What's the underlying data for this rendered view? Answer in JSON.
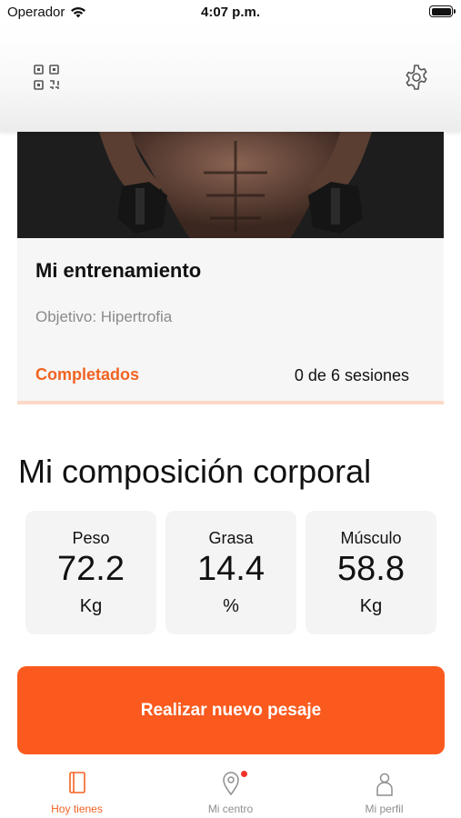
{
  "status_bar": {
    "carrier": "Operador",
    "time": "4:07 p.m."
  },
  "header": {
    "left_icon": "qr-code-icon",
    "right_icon": "gear-icon"
  },
  "training_card": {
    "title": "Mi entrenamiento",
    "subtitle": "Objetivo: Hipertrofia",
    "completed_label": "Completados",
    "sessions": "0 de 6 sesiones"
  },
  "composition": {
    "title": "Mi composición corporal",
    "stats": [
      {
        "label": "Peso",
        "value": "72.2",
        "unit": "Kg"
      },
      {
        "label": "Grasa",
        "value": "14.4",
        "unit": "%"
      },
      {
        "label": "Músculo",
        "value": "58.8",
        "unit": "Kg"
      }
    ]
  },
  "primary_action": "Realizar nuevo pesaje",
  "tabs": [
    {
      "label": "Hoy tienes",
      "icon": "book-icon",
      "active": true
    },
    {
      "label": "Mi centro",
      "icon": "location-pin-icon",
      "active": false,
      "badge": true
    },
    {
      "label": "Mi perfil",
      "icon": "person-icon",
      "active": false
    }
  ],
  "colors": {
    "accent": "#fa5a1e",
    "accent_text": "#f26322",
    "card_bg": "#f4f4f4",
    "badge": "#f0312a"
  }
}
